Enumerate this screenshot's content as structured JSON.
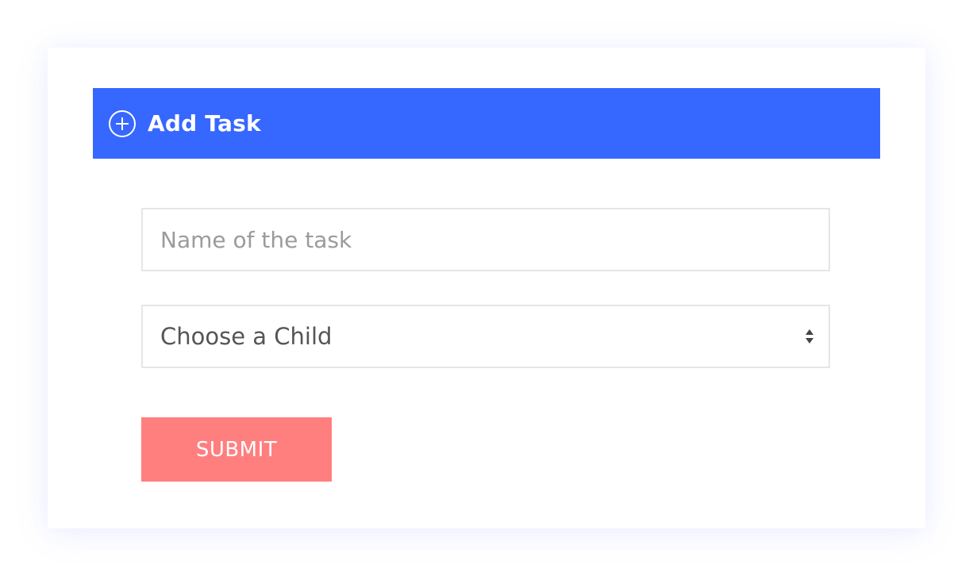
{
  "header": {
    "title": "Add Task",
    "icon": "plus-circle-icon",
    "background_color": "#3667ff"
  },
  "form": {
    "task_name": {
      "value": "",
      "placeholder": "Name of the task"
    },
    "child_select": {
      "selected": "Choose a Child",
      "icon": "sort-arrows-icon"
    },
    "submit": {
      "label": "SUBMIT",
      "color": "#ff7f7f"
    }
  }
}
